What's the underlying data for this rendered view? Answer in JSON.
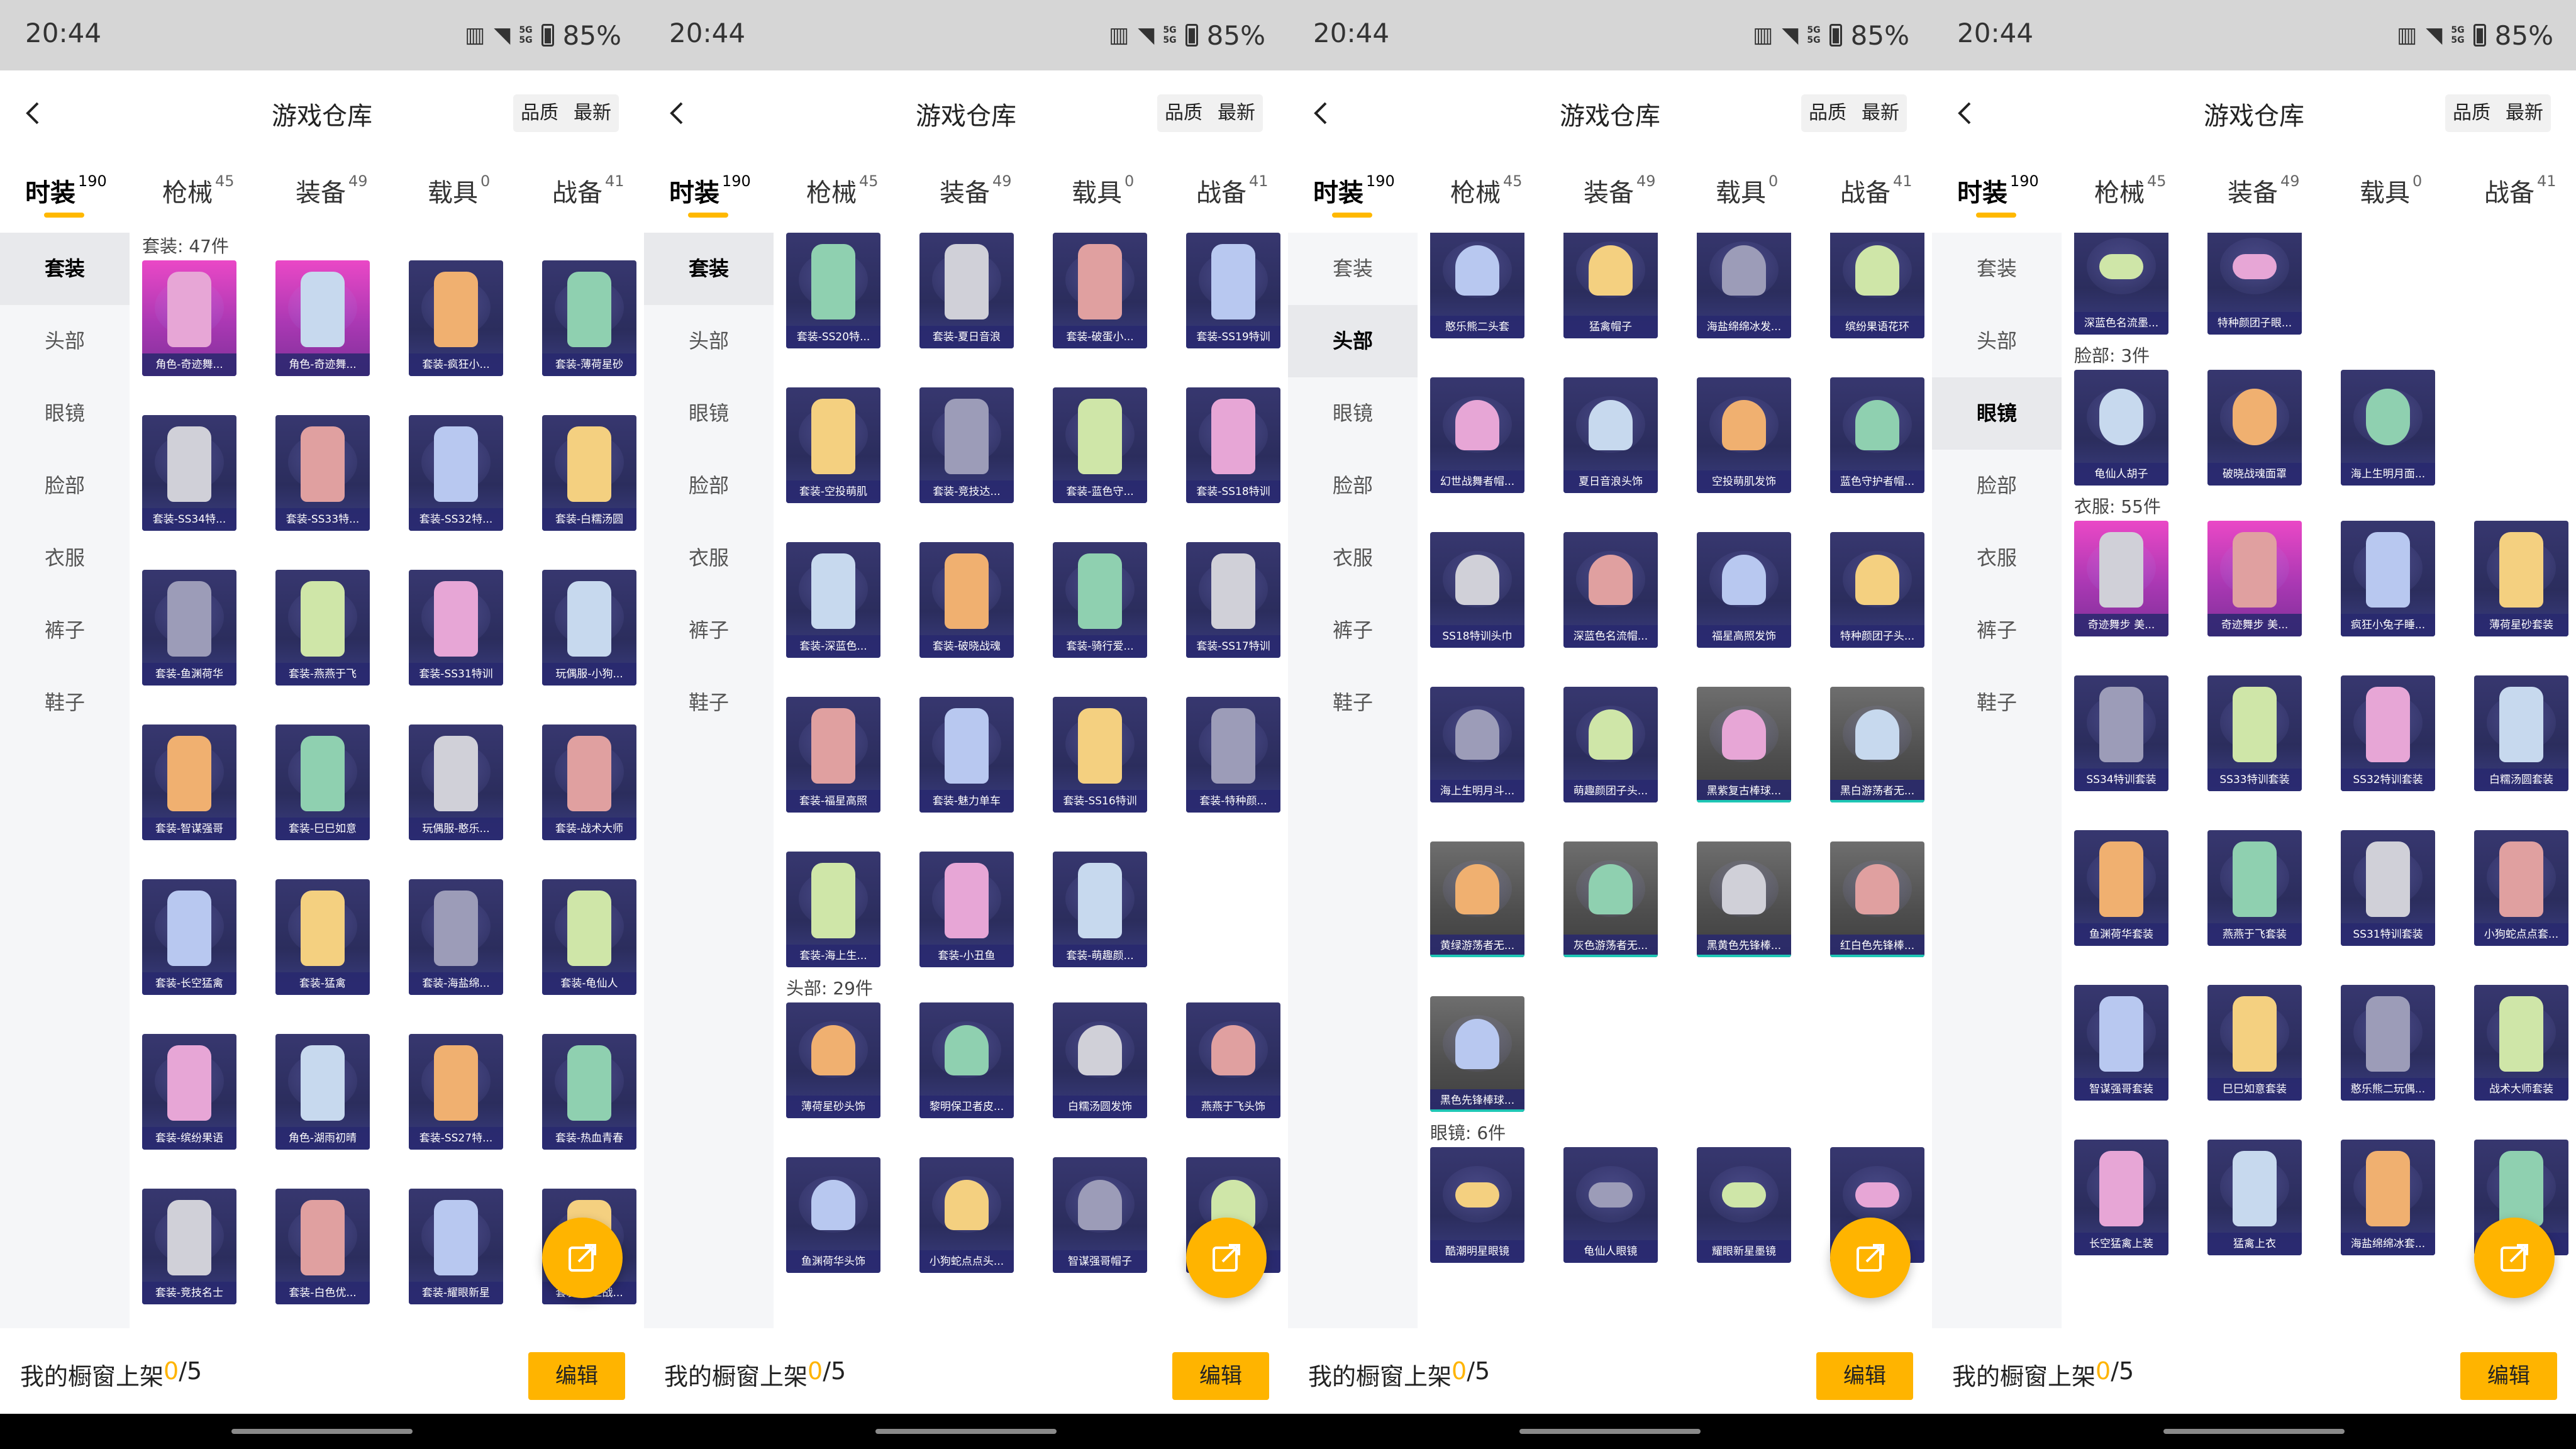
{
  "status_bar": {
    "time": "20:44",
    "battery": "85%",
    "network": [
      "5G",
      "5G"
    ]
  },
  "header": {
    "title": "游戏仓库",
    "sort_options": [
      "品质",
      "最新"
    ]
  },
  "tabs": [
    {
      "label": "时装",
      "count": "190"
    },
    {
      "label": "枪械",
      "count": "45"
    },
    {
      "label": "装备",
      "count": "49"
    },
    {
      "label": "载具",
      "count": "0"
    },
    {
      "label": "战备",
      "count": "41"
    }
  ],
  "sidebar": [
    "套装",
    "头部",
    "眼镜",
    "脸部",
    "衣服",
    "裤子",
    "鞋子"
  ],
  "footer": {
    "label": "我的橱窗上架 ",
    "count": "0",
    "total": "/5",
    "edit_label": "编辑"
  },
  "screens": [
    {
      "active_side": 0,
      "offset": 0,
      "sections": [
        {
          "title": "套装: 47件",
          "items": [
            {
              "label": "角色-奇迹舞...",
              "rarity": "pink",
              "icon": "outfit-icon"
            },
            {
              "label": "角色-奇迹舞...",
              "rarity": "pink",
              "icon": "outfit-icon"
            },
            {
              "label": "套装-疯狂小...",
              "rarity": "purple",
              "icon": "outfit-icon"
            },
            {
              "label": "套装-薄荷星砂",
              "rarity": "purple",
              "icon": "outfit-icon"
            },
            {
              "label": "套装-SS34特...",
              "rarity": "purple",
              "icon": "outfit-icon"
            },
            {
              "label": "套装-SS33特...",
              "rarity": "purple",
              "icon": "outfit-icon"
            },
            {
              "label": "套装-SS32特...",
              "rarity": "purple",
              "icon": "outfit-icon"
            },
            {
              "label": "套装-白糯汤圆",
              "rarity": "purple",
              "icon": "outfit-icon"
            },
            {
              "label": "套装-鱼渊荷华",
              "rarity": "purple",
              "icon": "outfit-icon"
            },
            {
              "label": "套装-燕燕于飞",
              "rarity": "purple",
              "icon": "outfit-icon"
            },
            {
              "label": "套装-SS31特训",
              "rarity": "purple",
              "icon": "outfit-icon"
            },
            {
              "label": "玩偶服-小狗...",
              "rarity": "purple",
              "icon": "outfit-icon"
            },
            {
              "label": "套装-智谋强哥",
              "rarity": "purple",
              "icon": "outfit-icon"
            },
            {
              "label": "套装-巳巳如意",
              "rarity": "purple",
              "icon": "outfit-icon"
            },
            {
              "label": "玩偶服-憨乐...",
              "rarity": "purple",
              "icon": "outfit-icon"
            },
            {
              "label": "套装-战术大师",
              "rarity": "purple",
              "icon": "outfit-icon"
            },
            {
              "label": "套装-长空猛禽",
              "rarity": "purple",
              "icon": "outfit-icon"
            },
            {
              "label": "套装-猛禽",
              "rarity": "purple",
              "icon": "outfit-icon"
            },
            {
              "label": "套装-海盐绵...",
              "rarity": "purple",
              "icon": "outfit-icon"
            },
            {
              "label": "套装-龟仙人",
              "rarity": "purple",
              "icon": "outfit-icon"
            },
            {
              "label": "套装-缤纷果语",
              "rarity": "purple",
              "icon": "outfit-icon"
            },
            {
              "label": "角色-湖雨初晴",
              "rarity": "purple",
              "icon": "outfit-icon"
            },
            {
              "label": "套装-SS27特...",
              "rarity": "purple",
              "icon": "outfit-icon"
            },
            {
              "label": "套装-热血青春",
              "rarity": "purple",
              "icon": "outfit-icon"
            },
            {
              "label": "套装-竞技名士",
              "rarity": "purple",
              "icon": "outfit-icon"
            },
            {
              "label": "套装-白色优...",
              "rarity": "purple",
              "icon": "outfit-icon"
            },
            {
              "label": "套装-耀眼新星",
              "rarity": "purple",
              "icon": "outfit-icon"
            },
            {
              "label": "套装-幻世战...",
              "rarity": "purple",
              "icon": "outfit-icon"
            }
          ]
        }
      ]
    },
    {
      "active_side": 0,
      "offset": -14,
      "sections": [
        {
          "title": "",
          "items": [
            {
              "label": "套装-SS20特...",
              "rarity": "purple",
              "icon": "outfit-icon"
            },
            {
              "label": "套装-夏日音浪",
              "rarity": "purple",
              "icon": "outfit-icon"
            },
            {
              "label": "套装-破蛋小...",
              "rarity": "purple",
              "icon": "outfit-icon"
            },
            {
              "label": "套装-SS19特训",
              "rarity": "purple",
              "icon": "outfit-icon"
            },
            {
              "label": "套装-空投萌肌",
              "rarity": "purple",
              "icon": "outfit-icon"
            },
            {
              "label": "套装-竞技达...",
              "rarity": "purple",
              "icon": "outfit-icon"
            },
            {
              "label": "套装-蓝色守...",
              "rarity": "purple",
              "icon": "outfit-icon"
            },
            {
              "label": "套装-SS18特训",
              "rarity": "purple",
              "icon": "outfit-icon"
            },
            {
              "label": "套装-深蓝色...",
              "rarity": "purple",
              "icon": "outfit-icon"
            },
            {
              "label": "套装-破晓战魂",
              "rarity": "purple",
              "icon": "outfit-icon"
            },
            {
              "label": "套装-骑行爱...",
              "rarity": "purple",
              "icon": "outfit-icon"
            },
            {
              "label": "套装-SS17特训",
              "rarity": "purple",
              "icon": "outfit-icon"
            },
            {
              "label": "套装-福星高照",
              "rarity": "purple",
              "icon": "outfit-icon"
            },
            {
              "label": "套装-魅力单车",
              "rarity": "purple",
              "icon": "outfit-icon"
            },
            {
              "label": "套装-SS16特训",
              "rarity": "purple",
              "icon": "outfit-icon"
            },
            {
              "label": "套装-特种颜...",
              "rarity": "purple",
              "icon": "outfit-icon"
            },
            {
              "label": "套装-海上生...",
              "rarity": "purple",
              "icon": "outfit-icon"
            },
            {
              "label": "套装-小丑鱼",
              "rarity": "purple",
              "icon": "outfit-icon"
            },
            {
              "label": "套装-萌趣颜...",
              "rarity": "purple",
              "icon": "outfit-icon"
            }
          ]
        },
        {
          "title": "头部: 29件",
          "items": [
            {
              "label": "薄荷星砂头饰",
              "rarity": "purple",
              "icon": "headwear-icon"
            },
            {
              "label": "黎明保卫者皮...",
              "rarity": "purple",
              "icon": "headwear-icon"
            },
            {
              "label": "白糯汤圆发饰",
              "rarity": "purple",
              "icon": "headwear-icon"
            },
            {
              "label": "燕燕于飞头饰",
              "rarity": "purple",
              "icon": "headwear-icon"
            },
            {
              "label": "鱼渊荷华头饰",
              "rarity": "purple",
              "icon": "headwear-icon"
            },
            {
              "label": "小狗蛇点点头...",
              "rarity": "purple",
              "icon": "headwear-icon"
            },
            {
              "label": "智谋强哥帽子",
              "rarity": "purple",
              "icon": "headwear-icon"
            },
            {
              "label": "...饰",
              "rarity": "purple",
              "icon": "headwear-icon"
            }
          ]
        }
      ]
    },
    {
      "active_side": 1,
      "offset": -30,
      "sections": [
        {
          "title": "",
          "items": [
            {
              "label": "憨乐熊二头套",
              "rarity": "purple",
              "icon": "headwear-icon"
            },
            {
              "label": "猛禽帽子",
              "rarity": "purple",
              "icon": "headwear-icon"
            },
            {
              "label": "海盐绵绵冰发...",
              "rarity": "purple",
              "icon": "headwear-icon"
            },
            {
              "label": "缤纷果语花环",
              "rarity": "purple",
              "icon": "headwear-icon"
            },
            {
              "label": "幻世战舞者帽...",
              "rarity": "purple",
              "icon": "headwear-icon"
            },
            {
              "label": "夏日音浪头饰",
              "rarity": "purple",
              "icon": "headwear-icon"
            },
            {
              "label": "空投萌肌发饰",
              "rarity": "purple",
              "icon": "headwear-icon"
            },
            {
              "label": "蓝色守护者帽...",
              "rarity": "purple",
              "icon": "headwear-icon"
            },
            {
              "label": "SS18特训头巾",
              "rarity": "purple",
              "icon": "headwear-icon"
            },
            {
              "label": "深蓝色名流帽...",
              "rarity": "purple",
              "icon": "headwear-icon"
            },
            {
              "label": "福星高照发饰",
              "rarity": "purple",
              "icon": "headwear-icon"
            },
            {
              "label": "特种颜团子头...",
              "rarity": "purple",
              "icon": "headwear-icon"
            },
            {
              "label": "海上生明月斗...",
              "rarity": "purple",
              "icon": "headwear-icon"
            },
            {
              "label": "萌趣颜团子头...",
              "rarity": "purple",
              "icon": "headwear-icon"
            },
            {
              "label": "黑紫复古棒球...",
              "rarity": "gray",
              "icon": "headwear-icon"
            },
            {
              "label": "黑白游荡者无...",
              "rarity": "gray",
              "icon": "headwear-icon"
            },
            {
              "label": "黄绿游荡者无...",
              "rarity": "gray",
              "icon": "headwear-icon"
            },
            {
              "label": "灰色游荡者无...",
              "rarity": "gray",
              "icon": "headwear-icon"
            },
            {
              "label": "黑黄色先锋棒...",
              "rarity": "gray",
              "icon": "headwear-icon"
            },
            {
              "label": "红白色先锋棒...",
              "rarity": "gray",
              "icon": "headwear-icon"
            },
            {
              "label": "黑色先锋棒球...",
              "rarity": "gray",
              "icon": "headwear-icon"
            }
          ]
        },
        {
          "title": "眼镜: 6件",
          "items": [
            {
              "label": "酷潮明星眼镜",
              "rarity": "purple",
              "icon": "glasses-icon"
            },
            {
              "label": "龟仙人眼镜",
              "rarity": "purple",
              "icon": "glasses-icon"
            },
            {
              "label": "耀眼新星墨镜",
              "rarity": "purple",
              "icon": "glasses-icon"
            },
            {
              "label": "",
              "rarity": "purple",
              "icon": "glasses-icon"
            }
          ]
        }
      ]
    },
    {
      "active_side": 2,
      "offset": -36,
      "sections": [
        {
          "title": "",
          "items": [
            {
              "label": "深蓝色名流墨...",
              "rarity": "purple",
              "icon": "glasses-icon"
            },
            {
              "label": "特种颜团子眼...",
              "rarity": "purple",
              "icon": "glasses-icon"
            }
          ]
        },
        {
          "title": "脸部: 3件",
          "items": [
            {
              "label": "龟仙人胡子",
              "rarity": "purple",
              "icon": "face-icon"
            },
            {
              "label": "破晓战魂面罩",
              "rarity": "purple",
              "icon": "face-icon"
            },
            {
              "label": "海上生明月面...",
              "rarity": "purple",
              "icon": "face-icon"
            }
          ]
        },
        {
          "title": "衣服: 55件",
          "items": [
            {
              "label": "奇迹舞步 美...",
              "rarity": "pink",
              "icon": "clothing-icon"
            },
            {
              "label": "奇迹舞步 美...",
              "rarity": "pink",
              "icon": "clothing-icon"
            },
            {
              "label": "疯狂小兔子睡...",
              "rarity": "purple",
              "icon": "clothing-icon"
            },
            {
              "label": "薄荷星砂套装",
              "rarity": "purple",
              "icon": "clothing-icon"
            },
            {
              "label": "SS34特训套装",
              "rarity": "purple",
              "icon": "clothing-icon"
            },
            {
              "label": "SS33特训套装",
              "rarity": "purple",
              "icon": "clothing-icon"
            },
            {
              "label": "SS32特训套装",
              "rarity": "purple",
              "icon": "clothing-icon"
            },
            {
              "label": "白糯汤圆套装",
              "rarity": "purple",
              "icon": "clothing-icon"
            },
            {
              "label": "鱼渊荷华套装",
              "rarity": "purple",
              "icon": "clothing-icon"
            },
            {
              "label": "燕燕于飞套装",
              "rarity": "purple",
              "icon": "clothing-icon"
            },
            {
              "label": "SS31特训套装",
              "rarity": "purple",
              "icon": "clothing-icon"
            },
            {
              "label": "小狗蛇点点套...",
              "rarity": "purple",
              "icon": "clothing-icon"
            },
            {
              "label": "智谋强哥套装",
              "rarity": "purple",
              "icon": "clothing-icon"
            },
            {
              "label": "巳巳如意套装",
              "rarity": "purple",
              "icon": "clothing-icon"
            },
            {
              "label": "憨乐熊二玩偶...",
              "rarity": "purple",
              "icon": "clothing-icon"
            },
            {
              "label": "战术大师套装",
              "rarity": "purple",
              "icon": "clothing-icon"
            },
            {
              "label": "长空猛禽上装",
              "rarity": "purple",
              "icon": "clothing-icon"
            },
            {
              "label": "猛禽上衣",
              "rarity": "purple",
              "icon": "clothing-icon"
            },
            {
              "label": "海盐绵绵冰套...",
              "rarity": "purple",
              "icon": "clothing-icon"
            },
            {
              "label": "",
              "rarity": "purple",
              "icon": "clothing-icon"
            }
          ]
        }
      ]
    }
  ]
}
